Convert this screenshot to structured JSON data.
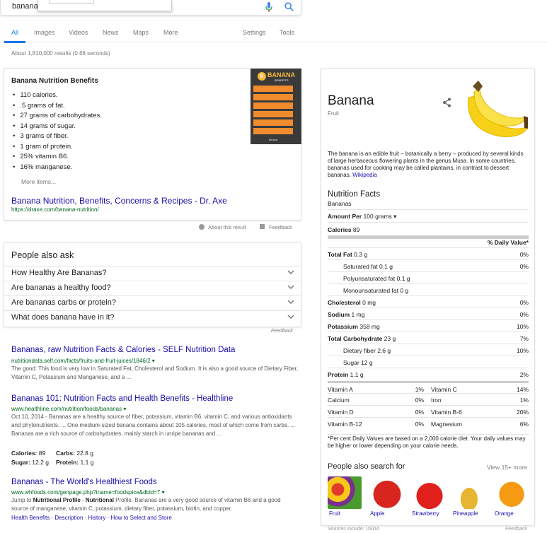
{
  "search": {
    "query": "banana"
  },
  "tabs": [
    "All",
    "Images",
    "Videos",
    "News",
    "Maps",
    "More",
    "Settings",
    "Tools"
  ],
  "stats": "About 1,810,000 results (0.68 seconds)",
  "featured": {
    "title": "Banana Nutrition Benefits",
    "items": [
      "110 calories.",
      ".5 grams of fat.",
      "27 grams of carbohydrates.",
      "14 grams of sugar.",
      "3 grams of fiber.",
      "1 gram of protein.",
      "25% vitamin B6.",
      "16% manganese."
    ],
    "more": "More items...",
    "link": "Banana Nutrition, Benefits, Concerns & Recipes - Dr. Axe",
    "url": "https://draxe.com/banana-nutrition/",
    "thumb_badge": "6",
    "thumb_title": "BANANA",
    "thumb_sub": "BENEFITS",
    "thumb_brand": "Dr.Axe",
    "about": "About this result",
    "feedback": "Feedback"
  },
  "paa": {
    "heading": "People also ask",
    "questions": [
      "How Healthy Are Bananas?",
      "Are bananas a healthy food?",
      "Are bananas carbs or protein?",
      "What does banana have in it?"
    ],
    "feedback": "Feedback"
  },
  "results": [
    {
      "title": "Bananas, raw Nutrition Facts & Calories - SELF Nutrition Data",
      "url": "nutritiondata.self.com/facts/fruits-and-fruit-juices/1846/2",
      "snippet": "The good: This food is very low in Saturated Fat, Cholesterol and Sodium. It is also a good source of Dietary Fiber, Vitamin C, Potassium and Manganese, and a ..."
    },
    {
      "title": "Bananas 101: Nutrition Facts and Health Benefits - Healthline",
      "url": "www.healthline.com/nutrition/foods/bananas",
      "snippet": "Oct 10, 2014 - Bananas are a healthy source of fiber, potassium, vitamin B6, vitamin C, and various antioxidants and phytonutrients. ... One medium-sized banana contains about 105 calories, most of which come from carbs. ... Bananas are a rich source of carbohydrates, mainly starch in unripe bananas and ...",
      "facts": [
        {
          "label": "Calories:",
          "value": "89"
        },
        {
          "label": "Carbs:",
          "value": "22.8 g"
        },
        {
          "label": "Sugar:",
          "value": "12.2 g"
        },
        {
          "label": "Protein:",
          "value": "1.1 g"
        }
      ]
    },
    {
      "title": "Bananas - The World's Healthiest Foods",
      "url": "www.whfoods.com/genpage.php?tname=foodspice&dbid=7",
      "snippet_pre": "Jump to ",
      "snippet_bold1": "Nutritional Profile",
      "snippet_mid": " - ",
      "snippet_bold2": "Nutritional",
      "snippet_post": " Profile. Bananas are a very good source of vitamin B6 and a good source of manganese, vitamin C, potassium, dietary fiber, potassium, biotin, and copper.",
      "sitelinks": [
        "Health Benefits",
        "Description",
        "History",
        "How to Select and Store"
      ]
    }
  ],
  "kg": {
    "title": "Banana",
    "subtitle": "Fruit",
    "description": "The banana is an edible fruit – botanically a berry – produced by several kinds of large herbaceous flowering plants in the genus Musa. In some countries, bananas used for cooking may be called plantains, in contrast to dessert bananas.",
    "wiki": "Wikipedia",
    "nf_title": "Nutrition Facts",
    "nf_sub": "Bananas",
    "amount": "Amount Per",
    "amount_val": "100 grams",
    "calories": "Calories",
    "calories_val": "89",
    "dv_header": "% Daily Value*",
    "rows": [
      {
        "label": "Total Fat",
        "amt": "0.3 g",
        "dv": "0%",
        "bold": true,
        "indent": false
      },
      {
        "label": "Saturated fat",
        "amt": "0.1 g",
        "dv": "0%",
        "bold": false,
        "indent": true
      },
      {
        "label": "Polyunsaturated fat",
        "amt": "0.1 g",
        "dv": "",
        "bold": false,
        "indent": true
      },
      {
        "label": "Monounsaturated fat",
        "amt": "0 g",
        "dv": "",
        "bold": false,
        "indent": true
      },
      {
        "label": "Cholesterol",
        "amt": "0 mg",
        "dv": "0%",
        "bold": true,
        "indent": false
      },
      {
        "label": "Sodium",
        "amt": "1 mg",
        "dv": "0%",
        "bold": true,
        "indent": false
      },
      {
        "label": "Potassium",
        "amt": "358 mg",
        "dv": "10%",
        "bold": true,
        "indent": false
      },
      {
        "label": "Total Carbohydrate",
        "amt": "23 g",
        "dv": "7%",
        "bold": true,
        "indent": false
      },
      {
        "label": "Dietary fiber",
        "amt": "2.6 g",
        "dv": "10%",
        "bold": false,
        "indent": true
      },
      {
        "label": "Sugar",
        "amt": "12 g",
        "dv": "",
        "bold": false,
        "indent": true
      },
      {
        "label": "Protein",
        "amt": "1.1 g",
        "dv": "2%",
        "bold": true,
        "indent": false
      }
    ],
    "vitamins": [
      [
        "Vitamin A",
        "1%",
        "Vitamin C",
        "14%"
      ],
      [
        "Calcium",
        "0%",
        "Iron",
        "1%"
      ],
      [
        "Vitamin D",
        "0%",
        "Vitamin B-6",
        "20%"
      ],
      [
        "Vitamin B-12",
        "0%",
        "Magnesium",
        "6%"
      ]
    ],
    "footnote": "*Per cent Daily Values are based on a 2,000 calorie diet. Your daily values may be higher or lower depending on your calorie needs.",
    "pasf": "People also search for",
    "view_more": "View 15+ more",
    "related": [
      "Fruit",
      "Apple",
      "Strawberry",
      "Pineapple",
      "Orange"
    ],
    "sources": "Sources include: USDA",
    "feedback": "Feedback"
  }
}
